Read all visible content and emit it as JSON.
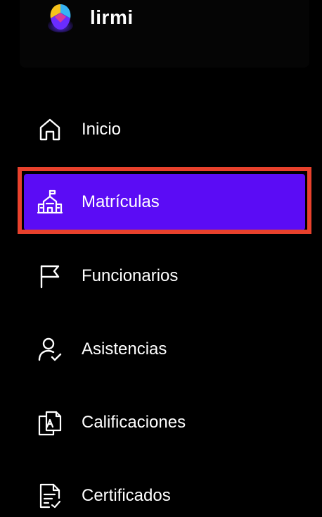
{
  "app": {
    "name": "lirmi"
  },
  "colors": {
    "background": "#000000",
    "active_item": "#5b0cf5",
    "highlight_border": "#e8412c",
    "text": "#ffffff"
  },
  "sidebar": {
    "items": [
      {
        "label": "Inicio",
        "icon": "home-icon",
        "active": false
      },
      {
        "label": "Matrículas",
        "icon": "school-building-icon",
        "active": true
      },
      {
        "label": "Funcionarios",
        "icon": "flag-icon",
        "active": false
      },
      {
        "label": "Asistencias",
        "icon": "user-check-icon",
        "active": false
      },
      {
        "label": "Calificaciones",
        "icon": "grade-documents-icon",
        "active": false
      },
      {
        "label": "Certificados",
        "icon": "document-check-icon",
        "active": false
      }
    ]
  }
}
